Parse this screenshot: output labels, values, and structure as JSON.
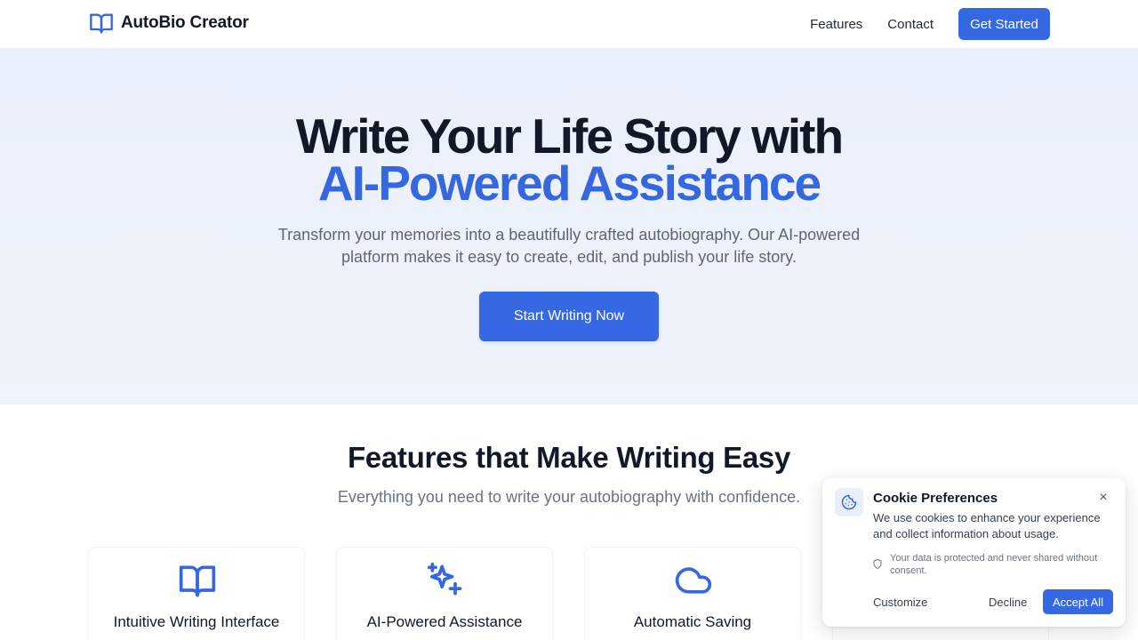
{
  "header": {
    "brand_name": "AutoBio Creator",
    "brand_icon": "book-open-icon",
    "nav": [
      {
        "label": "Features"
      },
      {
        "label": "Contact"
      }
    ],
    "cta_label": "Get Started"
  },
  "hero": {
    "title_line1": "Write Your Life Story with",
    "title_line2": "AI-Powered Assistance",
    "subtitle": "Transform your memories into a beautifully crafted autobiography. Our AI-powered platform makes it easy to create, edit, and publish your life story.",
    "cta_label": "Start Writing Now"
  },
  "features": {
    "title": "Features that Make Writing Easy",
    "subtitle": "Everything you need to write your autobiography with confidence.",
    "cards": [
      {
        "title": "Intuitive Writing Interface",
        "icon": "book-open-icon"
      },
      {
        "title": "AI-Powered Assistance",
        "icon": "sparkles-icon"
      },
      {
        "title": "Automatic Saving",
        "icon": "cloud-icon"
      },
      {
        "title": "",
        "icon": ""
      }
    ]
  },
  "cookie": {
    "title": "Cookie Preferences",
    "description": "We use cookies to enhance your experience and collect information about usage.",
    "note": "Your data is protected and never shared without consent.",
    "customize_label": "Customize",
    "decline_label": "Decline",
    "accept_label": "Accept All",
    "close_symbol": "×",
    "icon": "cookie-icon",
    "note_icon": "shield-icon"
  },
  "colors": {
    "primary": "#3668e3",
    "accent_text": "#3567e0",
    "hero_bg": "#eaf0fb",
    "heading": "#111827",
    "muted": "#6b7280"
  }
}
